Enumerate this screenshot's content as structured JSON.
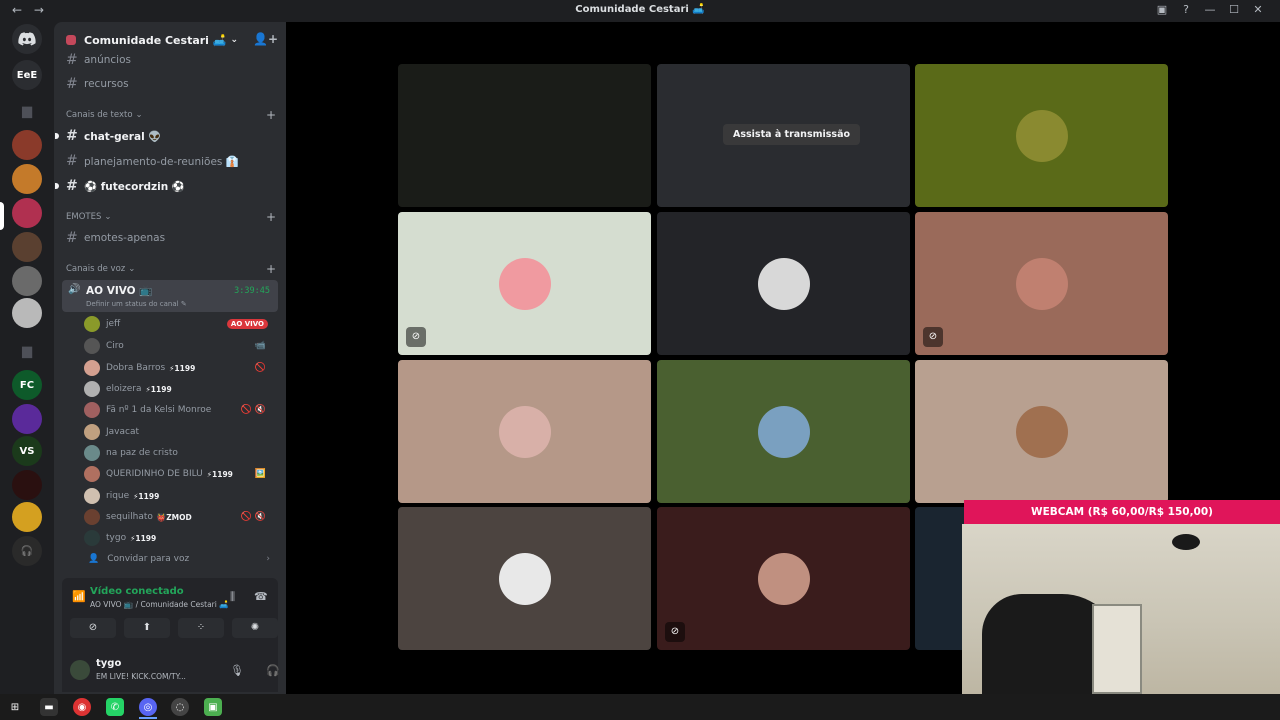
{
  "window": {
    "title": "Comunidade Cestari 🛋️",
    "nav_back": "←",
    "nav_forward": "→",
    "controls": [
      "▣",
      "?",
      "—",
      "☐",
      "✕"
    ]
  },
  "rail": {
    "home_label": "Discord",
    "servers": [
      {
        "label": "EeE",
        "color": "#2b2d31"
      },
      {
        "label": "",
        "color": "#8a3a2a"
      },
      {
        "label": "",
        "color": "#c47a2a"
      },
      {
        "label": "",
        "color": "#b03050"
      },
      {
        "label": "",
        "color": "#5a4030"
      },
      {
        "label": "",
        "color": "#6a6a6a"
      },
      {
        "label": "",
        "color": "#b9b9b9"
      },
      {
        "label": "FC",
        "color": "#0e5a2a"
      },
      {
        "label": "",
        "color": "#5a2a9a"
      },
      {
        "label": "VS",
        "color": "#1b3a1b"
      },
      {
        "label": "",
        "color": "#2a1010"
      },
      {
        "label": "",
        "color": "#d4a020"
      },
      {
        "label": "🎧",
        "color": "#2a2a2a"
      }
    ]
  },
  "sidebar": {
    "server_name": "Comunidade Cestari 🛋️",
    "channels_top": [
      {
        "name": "anúncios"
      },
      {
        "name": "recursos"
      }
    ],
    "text_category": "Canais de texto",
    "text_channels": [
      {
        "name": "chat-geral 👽",
        "unread": true
      },
      {
        "name": "planejamento-de-reuniões 👔",
        "unread": false
      },
      {
        "name": "⚽ futecordzin ⚽",
        "unread": true
      }
    ],
    "emotes_category": "EMOTES",
    "emote_channels": [
      {
        "name": "emotes-apenas"
      }
    ],
    "voice_category": "Canais de voz",
    "voice_channel": {
      "name": "AO VIVO 📺",
      "time": "3:39:45",
      "status": "Definir um status do canal"
    },
    "voice_users": [
      {
        "name": "jeff",
        "badge": "",
        "live": "AO VIVO",
        "icons": "",
        "color": "#8a9a2a"
      },
      {
        "name": "Ciro",
        "badge": "",
        "live": "",
        "icons": "📹",
        "color": "#555"
      },
      {
        "name": "Dobra Barros",
        "badge": "⚡1199",
        "live": "",
        "icons": "🚫",
        "color": "#d4a090"
      },
      {
        "name": "eloizera",
        "badge": "⚡1199",
        "live": "",
        "icons": "",
        "color": "#b0b0b0"
      },
      {
        "name": "Fã nº 1 da Kelsi Monroe",
        "badge": "",
        "live": "",
        "icons": "🚫 🔇",
        "color": "#a06060"
      },
      {
        "name": "Javacat",
        "badge": "",
        "live": "",
        "icons": "",
        "color": "#c0a080"
      },
      {
        "name": "na paz de cristo",
        "badge": "",
        "live": "",
        "icons": "",
        "color": "#6a8a8a"
      },
      {
        "name": "QUERIDINHO DE BILU",
        "badge": "⚡1199",
        "live": "",
        "icons": "🖼️",
        "color": "#b07060"
      },
      {
        "name": "rique",
        "badge": "⚡1199",
        "live": "",
        "icons": "",
        "color": "#d0c0b0"
      },
      {
        "name": "sequilhato",
        "badge": "👹ZMOD",
        "live": "",
        "icons": "🚫 🔇",
        "color": "#6a4030"
      },
      {
        "name": "tygo",
        "badge": "⚡1199",
        "live": "",
        "icons": "",
        "color": "#2a3a3a"
      }
    ],
    "invite_label": "Convidar para voz",
    "voice_connected": {
      "title": "Vídeo conectado",
      "subtitle": "AO VIVO 📺 / Comunidade Cestari 🛋️"
    },
    "user": {
      "name": "tygo",
      "status": "EM LIVE! KICK.COM/TY..."
    }
  },
  "stage": {
    "watch_label": "Assista à transmissão",
    "tiles": [
      {
        "bg": "#1a1c18",
        "avatar": "",
        "mute": false,
        "watch": false
      },
      {
        "bg": "#2a2c30",
        "avatar": "",
        "mute": false,
        "watch": true
      },
      {
        "bg": "#5a6a18",
        "avatar": "#8a8a30",
        "mute": false,
        "watch": false
      },
      {
        "bg": "#d5ddd0",
        "avatar": "#f09aa0",
        "mute": true,
        "watch": false
      },
      {
        "bg": "#232428",
        "avatar": "#d8d8d8",
        "mute": false,
        "watch": false
      },
      {
        "bg": "#9a6a5a",
        "avatar": "#c08070",
        "mute": true,
        "watch": false
      },
      {
        "bg": "#b59888",
        "avatar": "#d8b0a8",
        "mute": false,
        "watch": false
      },
      {
        "bg": "#4a6030",
        "avatar": "#7aa0c0",
        "mute": false,
        "watch": false
      },
      {
        "bg": "#b8a090",
        "avatar": "#a07050",
        "mute": false,
        "watch": false
      },
      {
        "bg": "#4c4440",
        "avatar": "#e8e8e8",
        "mute": false,
        "watch": false
      },
      {
        "bg": "#3a1c1c",
        "avatar": "#c09080",
        "mute": true,
        "watch": false
      },
      {
        "bg": "#1a2530",
        "avatar": "",
        "mute": false,
        "watch": false
      }
    ]
  },
  "webcam": {
    "banner": "WEBCAM (R$ 60,00/R$ 150,00)"
  },
  "taskbar": {
    "items": [
      "⊞",
      "▬",
      "◉",
      "✆",
      "◎",
      "◌",
      "▣"
    ]
  }
}
